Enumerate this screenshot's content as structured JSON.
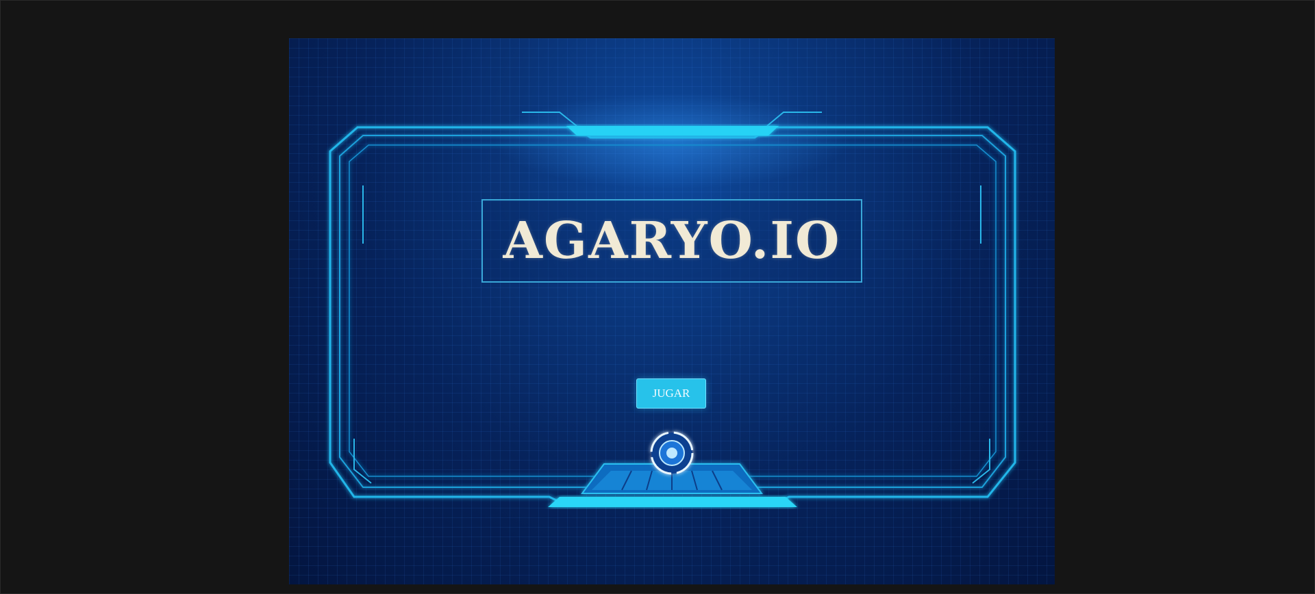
{
  "game": {
    "title": "AGARYO.IO",
    "play_button_label": "JUGAR"
  },
  "colors": {
    "page_background": "#151515",
    "canvas_background": "#062660",
    "frame_glow": "#22c6f0",
    "title_text": "#f1ead6",
    "title_border": "#3aa8d8",
    "button_background": "#27c2ea"
  },
  "icons": {
    "frame": "sci-fi-hud-frame",
    "emblem": "target-ring-icon"
  }
}
